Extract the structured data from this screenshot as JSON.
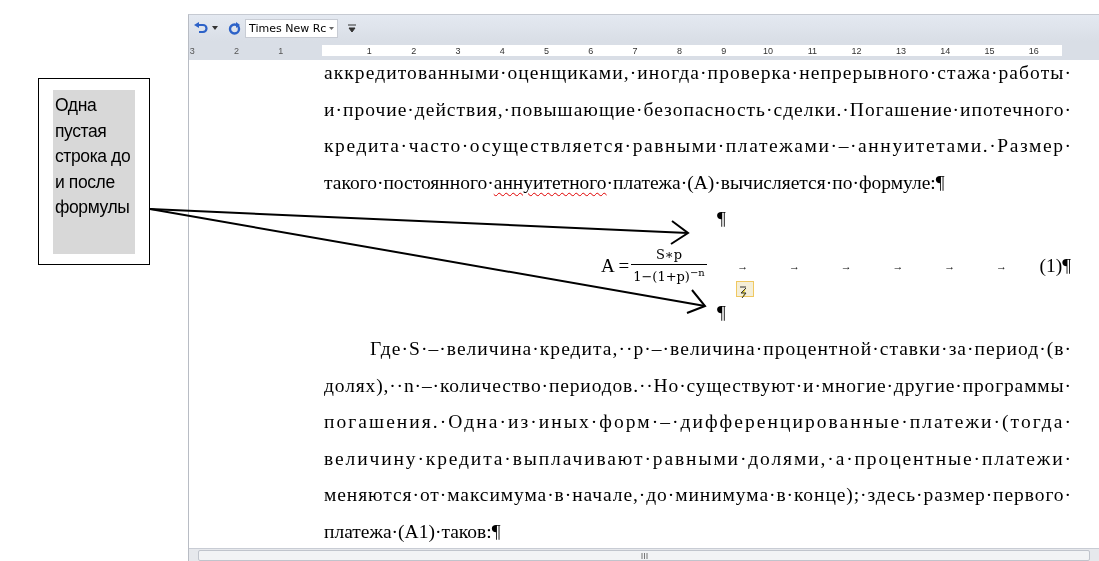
{
  "toolbar": {
    "font_name": "Times New Rc"
  },
  "ruler": {
    "left_numbers": [
      "3",
      "2",
      "1"
    ],
    "numbers": [
      "1",
      "2",
      "3",
      "4",
      "5",
      "6",
      "7",
      "8",
      "9",
      "10",
      "11",
      "12",
      "13",
      "14",
      "15",
      "16"
    ]
  },
  "document": {
    "blocks": [
      {
        "kind": "paragraph",
        "first_line_indent": false,
        "lines": [
          {
            "parts": [
              {
                "text": "аккредитованными·оценщиками,·иногда·проверка·непрерывного·стажа·работы·",
                "misspelled": false
              }
            ]
          },
          {
            "parts": [
              {
                "text": "и·прочие·действия,·повышающие·безопасность·сделки.·Погашение·ипотечного·",
                "misspelled": false
              }
            ]
          },
          {
            "parts": [
              {
                "text": "кредита·часто·осуществляется·равными·платежами·–·аннуитетами.·Размер·",
                "misspelled": false
              }
            ]
          },
          {
            "parts": [
              {
                "text": "такого·постоянного·",
                "misspelled": false
              },
              {
                "text": "аннуитетного",
                "misspelled": true
              },
              {
                "text": "·платежа·(А)·вычисляется·по·формуле:¶",
                "misspelled": false
              }
            ]
          }
        ]
      },
      {
        "kind": "mark",
        "text": "¶"
      },
      {
        "kind": "equation",
        "lhs": "A =",
        "numerator": "S∗p",
        "denominator": "1−(1+p)",
        "exponent": "−n",
        "tabs": [
          "→",
          "→",
          "→",
          "→",
          "→",
          "→"
        ],
        "number": "(1)¶"
      },
      {
        "kind": "mark",
        "text": "¶"
      },
      {
        "kind": "paragraph",
        "first_line_indent": true,
        "lines": [
          {
            "parts": [
              {
                "text": "Где·S·–·величина·кредита,··p·–·величина·процентной·ставки·за·период·(в·",
                "misspelled": false
              }
            ]
          },
          {
            "parts": [
              {
                "text": "долях),··n·–·количество·периодов.··Но·существуют·и·многие·другие·программы·",
                "misspelled": false
              }
            ]
          },
          {
            "parts": [
              {
                "text": "погашения.·Одна·из·иных·форм·–·дифференцированные·платежи·(тогда·",
                "misspelled": false
              }
            ]
          },
          {
            "parts": [
              {
                "text": "величину·кредита·выплачивают·равными·долями,·а·процентные·платежи·",
                "misspelled": false
              }
            ]
          },
          {
            "parts": [
              {
                "text": "меняются·от·максимума·в·начале,·до·минимума·в·конце);·здесь·размер·первого·",
                "misspelled": false
              }
            ]
          },
          {
            "parts": [
              {
                "text": "платежа·(А1)·таков:¶",
                "misspelled": false
              }
            ]
          }
        ]
      }
    ]
  },
  "callout": {
    "text": "Одна пустая строка до и после формулы"
  }
}
